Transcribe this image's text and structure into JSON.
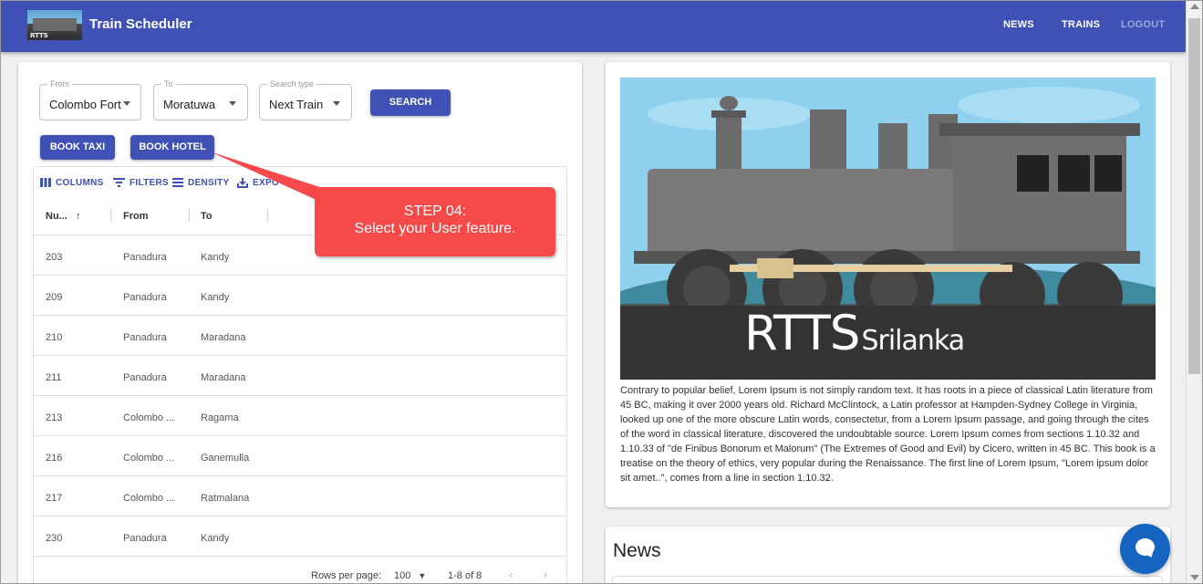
{
  "header": {
    "logo_text": "RTTS",
    "title": "Train Scheduler",
    "nav": [
      "NEWS",
      "TRAINS",
      "LOGOUT"
    ],
    "color": "#3f51b5"
  },
  "search": {
    "from_label": "From",
    "from_value": "Colombo Fort",
    "to_label": "To",
    "to_value": "Moratuwa",
    "type_label": "Search type",
    "type_value": "Next Train",
    "search_button": "SEARCH"
  },
  "actions": {
    "book_taxi": "BOOK TAXI",
    "book_hotel": "BOOK HOTEL"
  },
  "toolbar": {
    "columns": "COLUMNS",
    "filters": "FILTERS",
    "density": "DENSITY",
    "export": "EXPO"
  },
  "table": {
    "headers": [
      "Nu...",
      "From",
      "To"
    ],
    "rows": [
      {
        "num": "203",
        "from": "Panadura",
        "to": "Kandy"
      },
      {
        "num": "209",
        "from": "Panadura",
        "to": "Kandy"
      },
      {
        "num": "210",
        "from": "Panadura",
        "to": "Maradana"
      },
      {
        "num": "211",
        "from": "Panadura",
        "to": "Maradana"
      },
      {
        "num": "213",
        "from": "Colombo ...",
        "to": "Ragama"
      },
      {
        "num": "216",
        "from": "Colombo ...",
        "to": "Ganemulla"
      },
      {
        "num": "217",
        "from": "Colombo ...",
        "to": "Ratmalana"
      },
      {
        "num": "230",
        "from": "Panadura",
        "to": "Kandy"
      }
    ],
    "rows_per_page_label": "Rows per page:",
    "rows_per_page": "100",
    "range": "1-8 of 8"
  },
  "callout": {
    "line1": "STEP 04:",
    "line2": "Select your User feature.",
    "color": "#f64a4a"
  },
  "hero": {
    "title_big": "RTTS",
    "title_small": "Srilanka",
    "description": "Contrary to popular belief, Lorem Ipsum is not simply random text. It has roots in a piece of classical Latin literature from 45 BC, making it over 2000 years old. Richard McClintock, a Latin professor at Hampden-Sydney College in Virginia, looked up one of the more obscure Latin words, consectetur, from a Lorem Ipsum passage, and going through the cites of the word in classical literature, discovered the undoubtable source. Lorem Ipsum comes from sections 1.10.32 and 1.10.33 of \"de Finibus Bonorum et Malorum\" (The Extremes of Good and Evil) by Cicero, written in 45 BC. This book is a treatise on the theory of ethics, very popular during the Renaissance. The first line of Lorem Ipsum, \"Lorem ipsum dolor sit amet..\", comes from a line in section 1.10.32."
  },
  "news": {
    "title": "News"
  },
  "icons": [
    "dropdown-arrow-icon",
    "columns-icon",
    "filter-icon",
    "density-icon",
    "export-icon",
    "sort-up-icon",
    "chevron-left-icon",
    "chevron-right-icon",
    "chat-icon"
  ]
}
